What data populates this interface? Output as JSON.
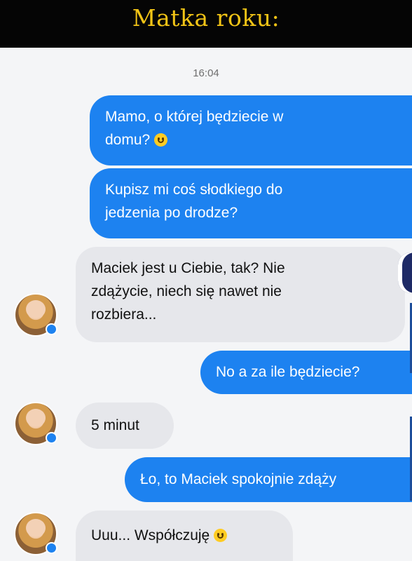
{
  "header": {
    "title": "Matka roku:"
  },
  "conversation": {
    "timestamp": "16:04",
    "messages": [
      {
        "sender": "me",
        "lines": [
          "Mamo, o której będziecie w",
          "domu?"
        ],
        "emoji": "smiley-emoji"
      },
      {
        "sender": "me",
        "lines": [
          "Kupisz mi coś słodkiego do",
          "jedzenia po drodze?"
        ]
      },
      {
        "sender": "mother",
        "lines": [
          "Maciek jest u Ciebie, tak? Nie",
          "zdążycie, niech się nawet nie",
          "rozbiera..."
        ]
      },
      {
        "sender": "me",
        "lines": [
          "No a za ile będziecie?"
        ]
      },
      {
        "sender": "mother",
        "lines": [
          "5 minut"
        ]
      },
      {
        "sender": "me",
        "lines": [
          "Ło, to Maciek spokojnie zdąży"
        ]
      },
      {
        "sender": "mother",
        "lines": [
          "Uuu... Współczuję"
        ],
        "emoji": "smiley-emoji"
      }
    ]
  },
  "colors": {
    "header_bg": "#050505",
    "header_text": "#f2c416",
    "outgoing_bubble": "#1d82f0",
    "incoming_bubble": "#e6e7eb"
  }
}
